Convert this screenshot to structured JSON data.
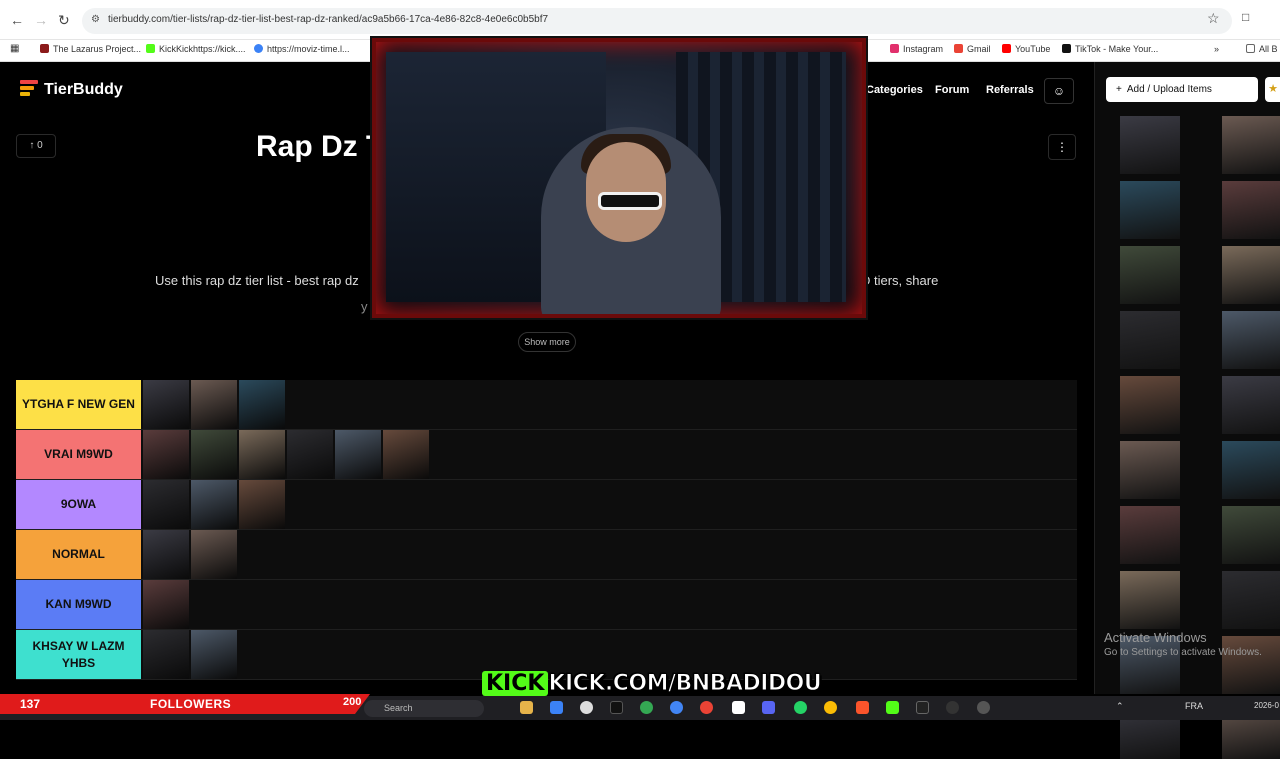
{
  "browser": {
    "url": "tierbuddy.com/tier-lists/rap-dz-tier-list-best-rap-dz-ranked/ac9a5b66-17ca-4e86-82c8-4e0e6c0b5bf7",
    "bookmarks": [
      "The Lazarus Project...",
      "KickKickhttps://kick....",
      "https://moviz-time.l...",
      "Instagram",
      "Gmail",
      "YouTube",
      "TikTok - Make Your..."
    ],
    "all_bookmarks": "All B"
  },
  "app": {
    "logo": "TierBuddy",
    "nav": [
      "Categories",
      "Forum",
      "Referrals"
    ],
    "upvotes": "0",
    "title": "Rap Dz T",
    "description_left": "Use this rap dz tier list - best rap dz",
    "description_right": "D tiers, share",
    "description_line2": "y",
    "show_more": "Show more"
  },
  "tiers": [
    {
      "label": "YTGHA F NEW GEN",
      "color": "#fde047",
      "items": 3
    },
    {
      "label": "VRAI M9WD",
      "color": "#f47373",
      "items": 6
    },
    {
      "label": "9OWA",
      "color": "#b388ff",
      "items": 3
    },
    {
      "label": "NORMAL",
      "color": "#f5a23b",
      "items": 2
    },
    {
      "label": "KAN M9WD",
      "color": "#5b7cf5",
      "items": 1
    },
    {
      "label": "KHSAY W LAZM YHBS",
      "color": "#3ee0cf",
      "items": 2
    }
  ],
  "panel": {
    "add_button": "Add / Upload Items",
    "activate_title": "Activate Windows",
    "activate_sub": "Go to Settings to activate Windows."
  },
  "stream": {
    "followers_count": "137",
    "followers_label": "FOLLOWERS",
    "followers_goal": "200",
    "kick_logo": "KICK",
    "kick_link": "KICK.COM/BNBADIDOU"
  },
  "taskbar": {
    "search": "Search",
    "lang": "FRA",
    "clock": "2026-0"
  }
}
